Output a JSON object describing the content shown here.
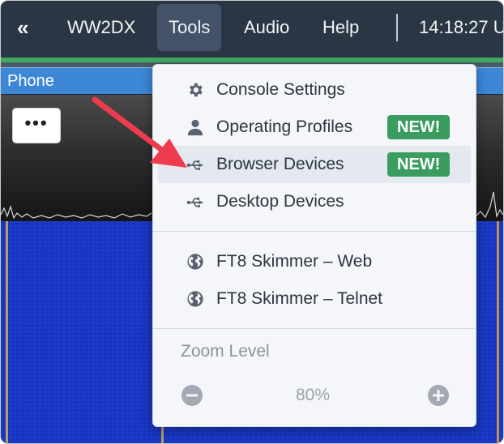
{
  "navbar": {
    "collapse_label": "«",
    "items": [
      {
        "label": "WW2DX"
      },
      {
        "label": "Tools"
      },
      {
        "label": "Audio"
      },
      {
        "label": "Help"
      }
    ],
    "clock": "14:18:27 U"
  },
  "panel": {
    "title": "Phone",
    "more_label": "•••"
  },
  "tools_menu": {
    "items": [
      {
        "label": "Console Settings",
        "icon": "gear-icon",
        "badge": ""
      },
      {
        "label": "Operating Profiles",
        "icon": "user-icon",
        "badge": "NEW!"
      },
      {
        "label": "Browser Devices",
        "icon": "usb-icon",
        "badge": "NEW!"
      },
      {
        "label": "Desktop Devices",
        "icon": "usb-icon",
        "badge": ""
      },
      {
        "label": "FT8 Skimmer – Web",
        "icon": "globe-icon",
        "badge": ""
      },
      {
        "label": "FT8 Skimmer – Telnet",
        "icon": "globe-icon",
        "badge": ""
      }
    ],
    "zoom": {
      "label": "Zoom Level",
      "value": "80%"
    }
  },
  "colors": {
    "navbar": "#2b3644",
    "panel_header": "#3c87d6",
    "badge": "#3a9d5f",
    "arrow": "#ee3b4d",
    "waterfall": "#1e3fd0"
  }
}
